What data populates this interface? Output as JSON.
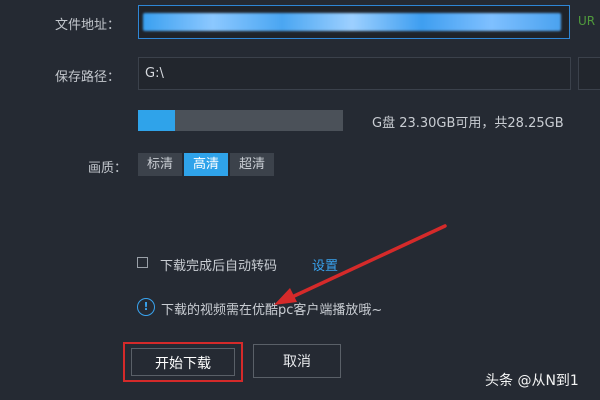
{
  "form": {
    "url_label": "文件地址：",
    "url_hint": "UR",
    "path_label": "保存路径：",
    "path_value": "G:\\",
    "disk_usage_fraction": 0.18,
    "disk_text": "G盘 23.30GB可用，共28.25GB",
    "quality_label": "画质：",
    "quality_options": [
      "标清",
      "高清",
      "超清"
    ],
    "quality_selected": "高清",
    "autoconvert_label": "下载完成后自动转码",
    "autoconvert_checked": false,
    "settings_link": "设置",
    "notice": "下载的视频需在优酷pc客户端播放哦~",
    "start_button": "开始下载",
    "cancel_button": "取消"
  },
  "annotations": {
    "highlight_color": "#d52a2a",
    "arrow_color": "#d52a2a"
  },
  "watermark": "头条 @从N到1",
  "colors": {
    "accent": "#2fa3ea",
    "background": "#252a33"
  }
}
